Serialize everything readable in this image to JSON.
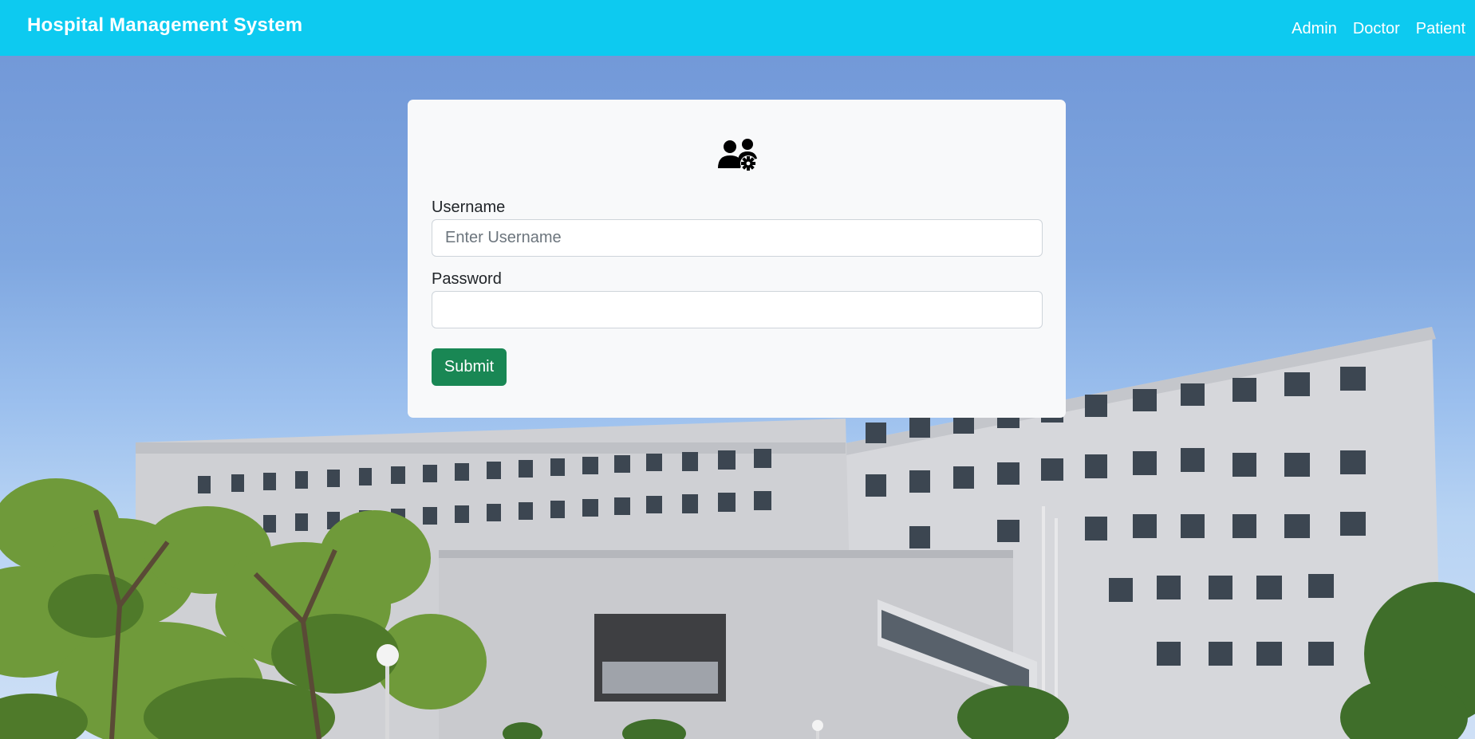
{
  "navbar": {
    "brand": "Hospital Management System",
    "links": [
      "Admin",
      "Doctor",
      "Patient"
    ]
  },
  "login_form": {
    "icon": "users-gear-icon",
    "username_label": "Username",
    "username_placeholder": "Enter Username",
    "username_value": "",
    "password_label": "Password",
    "password_value": "",
    "submit_label": "Submit"
  },
  "colors": {
    "navbar_bg": "#0dcaf0",
    "submit_bg": "#198754",
    "card_bg": "#f8f9fa"
  }
}
